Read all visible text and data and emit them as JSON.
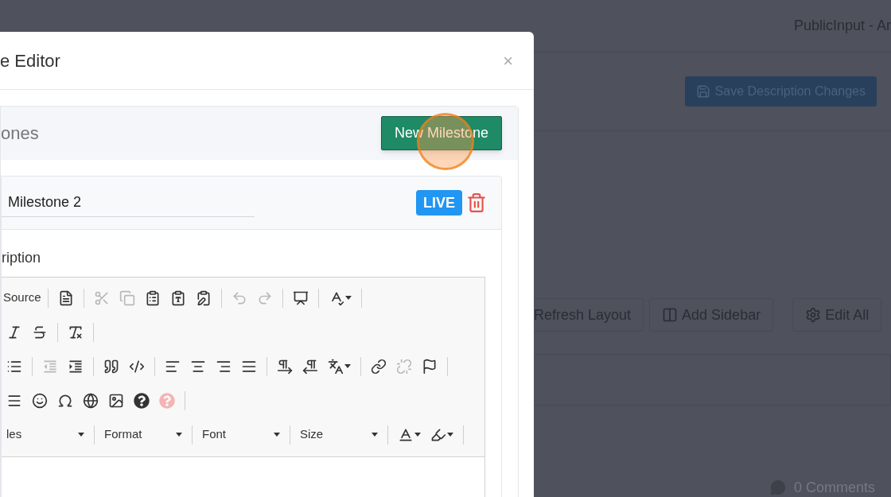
{
  "page": {
    "title": "PublicInput - Ar",
    "save_button": "Save Description Changes",
    "layout_buttons": [
      "Refresh Layout",
      "Add Sidebar",
      "Edit All"
    ],
    "comments": "0 Comments"
  },
  "modal": {
    "title": "e Editor",
    "close": "×",
    "section_title": "ones",
    "new_button": "New Milestone",
    "milestone": {
      "name": "Milestone 2",
      "badge": "LIVE",
      "description_label": "ription"
    },
    "toolbar_rows": [
      [
        {
          "kind": "label",
          "text": "Source"
        },
        {
          "kind": "separator"
        },
        {
          "kind": "icon",
          "disabled": false
        },
        {
          "kind": "separator"
        },
        {
          "kind": "icon",
          "disabled": true
        },
        {
          "kind": "icon",
          "disabled": true
        },
        {
          "kind": "icon",
          "disabled": false
        },
        {
          "kind": "icon",
          "disabled": false
        },
        {
          "kind": "icon",
          "disabled": false
        },
        {
          "kind": "separator"
        },
        {
          "kind": "icon",
          "disabled": true
        },
        {
          "kind": "icon",
          "disabled": true
        },
        {
          "kind": "separator"
        },
        {
          "kind": "icon",
          "disabled": false
        },
        {
          "kind": "separator"
        },
        {
          "kind": "menu_icon",
          "disabled": false
        },
        {
          "kind": "separator"
        }
      ],
      [
        {
          "kind": "icon",
          "disabled": false
        },
        {
          "kind": "icon",
          "disabled": false
        },
        {
          "kind": "separator"
        },
        {
          "kind": "icon",
          "disabled": false
        },
        {
          "kind": "separator"
        }
      ],
      [
        {
          "kind": "icon",
          "disabled": false
        },
        {
          "kind": "separator"
        },
        {
          "kind": "icon",
          "disabled": true
        },
        {
          "kind": "icon",
          "disabled": false
        },
        {
          "kind": "separator"
        },
        {
          "kind": "icon",
          "disabled": false
        },
        {
          "kind": "icon",
          "disabled": false
        },
        {
          "kind": "separator"
        },
        {
          "kind": "icon",
          "disabled": false
        },
        {
          "kind": "icon",
          "disabled": false
        },
        {
          "kind": "icon",
          "disabled": false
        },
        {
          "kind": "icon",
          "disabled": false
        },
        {
          "kind": "separator"
        },
        {
          "kind": "icon",
          "disabled": false
        },
        {
          "kind": "icon",
          "disabled": false
        },
        {
          "kind": "menu_icon",
          "disabled": false
        },
        {
          "kind": "separator"
        },
        {
          "kind": "icon",
          "disabled": false
        },
        {
          "kind": "icon",
          "disabled": true
        },
        {
          "kind": "icon",
          "disabled": false
        },
        {
          "kind": "separator"
        }
      ],
      [
        {
          "kind": "icon",
          "disabled": false
        },
        {
          "kind": "icon",
          "disabled": false
        },
        {
          "kind": "icon",
          "disabled": false
        },
        {
          "kind": "icon",
          "disabled": false
        },
        {
          "kind": "icon",
          "disabled": false
        },
        {
          "kind": "icon",
          "disabled": false
        },
        {
          "kind": "icon",
          "disabled": false
        },
        {
          "kind": "separator"
        }
      ],
      [
        {
          "kind": "combo",
          "text": "les"
        },
        {
          "kind": "separator"
        },
        {
          "kind": "combo",
          "text": "Format"
        },
        {
          "kind": "separator"
        },
        {
          "kind": "combo",
          "text": "Font"
        },
        {
          "kind": "separator"
        },
        {
          "kind": "combo",
          "text": "Size"
        },
        {
          "kind": "separator"
        },
        {
          "kind": "menu_icon",
          "disabled": false
        },
        {
          "kind": "menu_icon",
          "disabled": false
        },
        {
          "kind": "separator"
        }
      ]
    ]
  }
}
